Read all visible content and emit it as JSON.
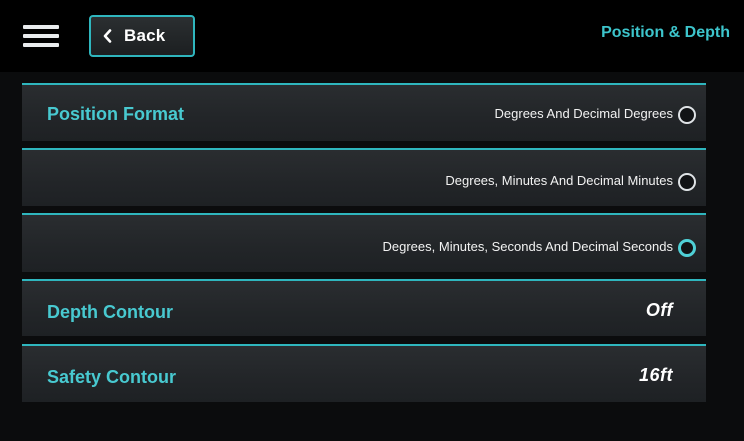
{
  "header": {
    "back_label": "Back",
    "title": "Position & Depth"
  },
  "position_format": {
    "label": "Position Format",
    "options": [
      {
        "label": "Degrees And Decimal Degrees",
        "selected": false
      },
      {
        "label": "Degrees, Minutes And Decimal Minutes",
        "selected": false
      },
      {
        "label": "Degrees, Minutes, Seconds And Decimal Seconds",
        "selected": true
      }
    ]
  },
  "depth_contour": {
    "label": "Depth Contour",
    "value": "Off"
  },
  "safety_contour": {
    "label": "Safety Contour",
    "value": "16ft"
  },
  "colors": {
    "accent": "#2fb6be",
    "accent_text": "#48c9d0",
    "background": "#0b0c0d",
    "row": "#24272a"
  }
}
